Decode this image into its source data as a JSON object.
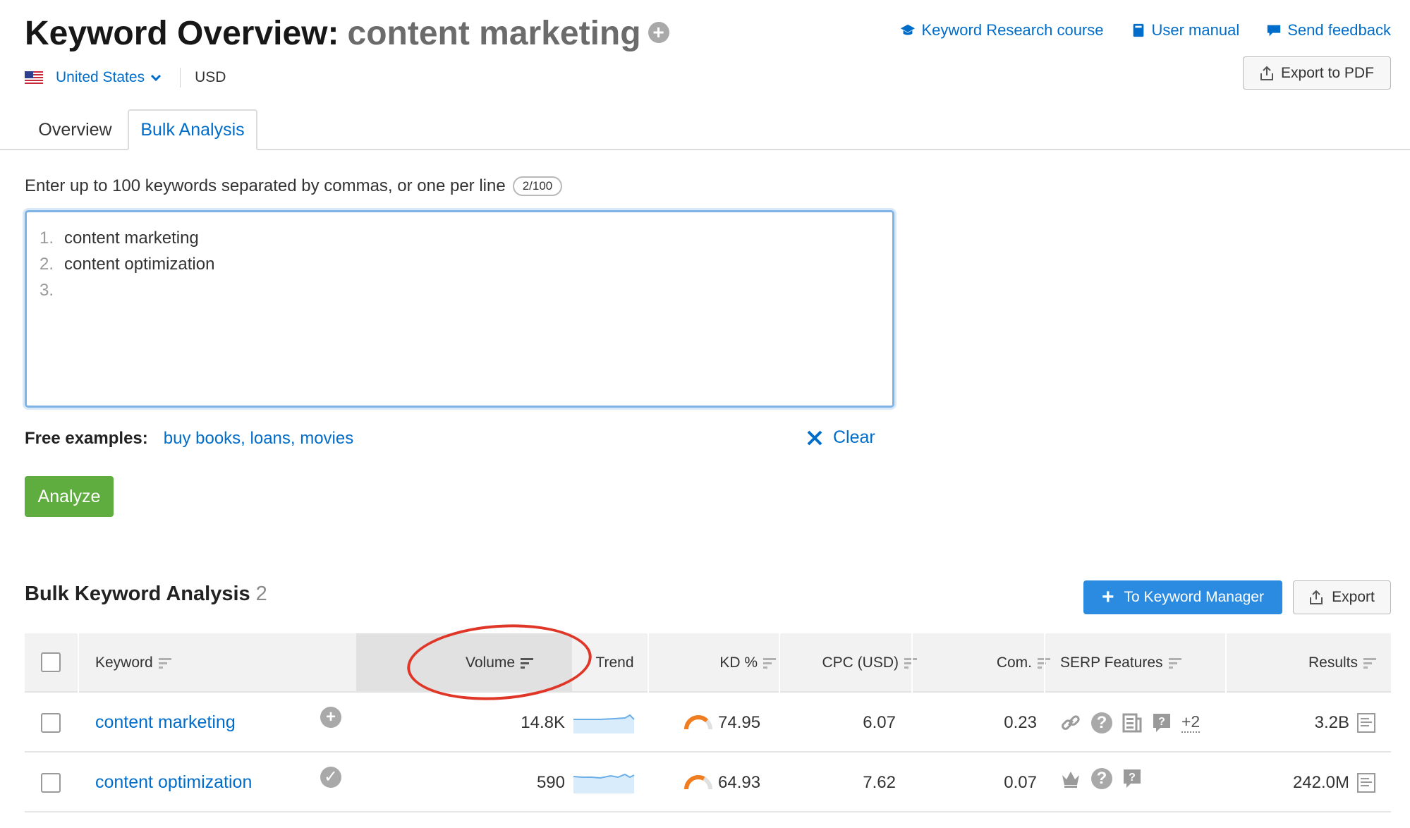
{
  "header": {
    "title": "Keyword Overview:",
    "keyword": "content marketing",
    "links": {
      "course": "Keyword Research course",
      "manual": "User manual",
      "feedback": "Send feedback"
    },
    "export_pdf": "Export to PDF",
    "country": "United States",
    "currency": "USD"
  },
  "tabs": {
    "overview": "Overview",
    "bulk": "Bulk Analysis"
  },
  "bulk_input": {
    "instruction": "Enter up to 100 keywords separated by commas, or one per line",
    "counter": "2/100",
    "lines": [
      {
        "num": "1.",
        "text": "content marketing"
      },
      {
        "num": "2.",
        "text": "content optimization"
      },
      {
        "num": "3.",
        "text": ""
      }
    ],
    "free_label": "Free examples:",
    "free_examples": "buy books, loans, movies",
    "clear_label": "Clear",
    "analyze_label": "Analyze"
  },
  "results": {
    "title": "Bulk Keyword Analysis",
    "count": "2",
    "to_keyword_manager": "To Keyword Manager",
    "export": "Export",
    "columns": {
      "keyword": "Keyword",
      "volume": "Volume",
      "trend": "Trend",
      "kd": "KD %",
      "cpc": "CPC (USD)",
      "com": "Com.",
      "serp": "SERP Features",
      "results": "Results"
    },
    "rows": [
      {
        "keyword": "content marketing",
        "action_icon": "add-circle-icon",
        "volume": "14.8K",
        "kd": "74.95",
        "kd_color": "#f07d1f",
        "cpc": "6.07",
        "com": "0.23",
        "serp_icons": [
          "link-icon",
          "question-icon",
          "news-icon",
          "faq-icon"
        ],
        "serp_more": "+2",
        "results": "3.2B"
      },
      {
        "keyword": "content optimization",
        "action_icon": "check-circle-icon",
        "volume": "590",
        "kd": "64.93",
        "kd_color": "#f07d1f",
        "cpc": "7.62",
        "com": "0.07",
        "serp_icons": [
          "crown-icon",
          "question-icon",
          "faq-icon"
        ],
        "serp_more": "",
        "results": "242.0M"
      }
    ]
  },
  "colors": {
    "link": "#006dca",
    "analyze": "#5fad3f",
    "primary_button": "#2b8be0",
    "annotation": "#e03628"
  }
}
